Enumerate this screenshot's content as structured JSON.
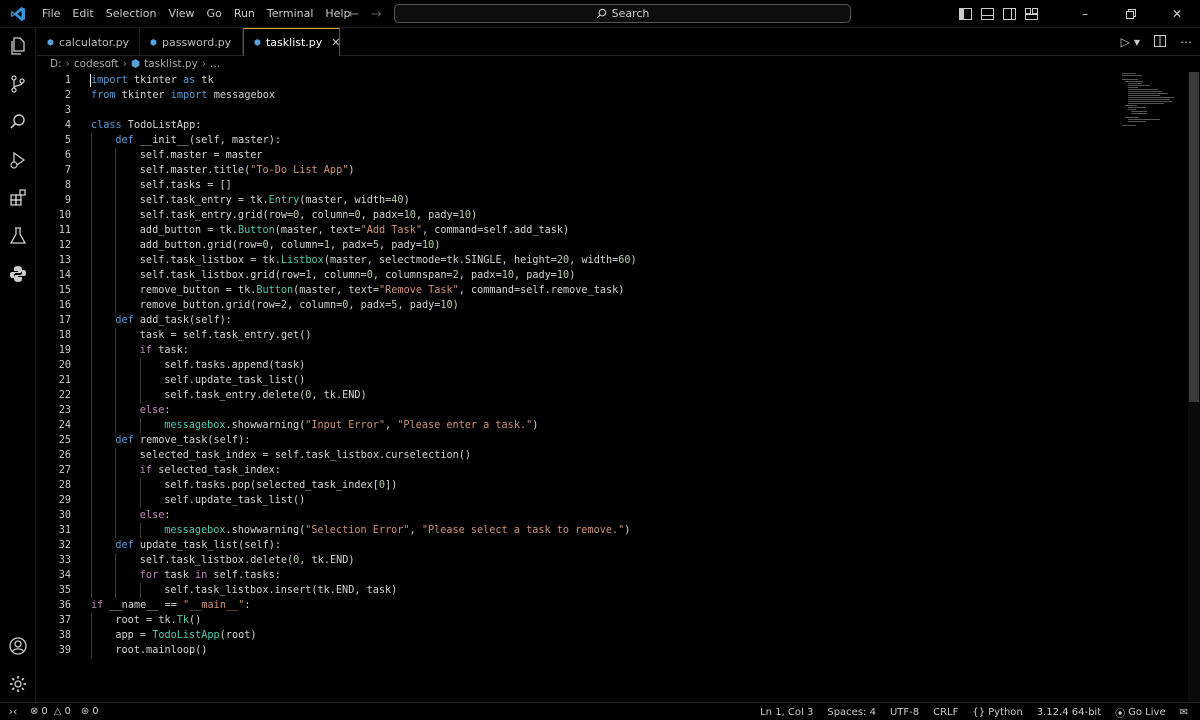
{
  "menu": [
    "File",
    "Edit",
    "Selection",
    "View",
    "Go",
    "Run",
    "Terminal",
    "Help"
  ],
  "search": {
    "label": "Search"
  },
  "tabs": [
    {
      "label": "calculator.py",
      "active": false
    },
    {
      "label": "password.py",
      "active": false
    },
    {
      "label": "tasklist.py",
      "active": true
    }
  ],
  "breadcrumb": {
    "drive": "D:",
    "folder": "codesoft",
    "file": "tasklist.py",
    "more": "..."
  },
  "code_lines": [
    {
      "n": "1",
      "indent": 0,
      "tokens": [
        [
          "import",
          "kw"
        ],
        [
          " tkinter ",
          "plain"
        ],
        [
          "as",
          "kw"
        ],
        [
          " tk",
          "plain"
        ]
      ]
    },
    {
      "n": "2",
      "indent": 0,
      "tokens": [
        [
          "from",
          "kw"
        ],
        [
          " tkinter ",
          "plain"
        ],
        [
          "import",
          "kw"
        ],
        [
          " messagebox",
          "plain"
        ]
      ]
    },
    {
      "n": "3",
      "indent": 0,
      "tokens": []
    },
    {
      "n": "4",
      "indent": 0,
      "tokens": [
        [
          "class",
          "kw"
        ],
        [
          " TodoListApp:",
          "plain"
        ]
      ]
    },
    {
      "n": "5",
      "indent": 1,
      "tokens": [
        [
          "def",
          "kw"
        ],
        [
          " __init__(self, master):",
          "plain"
        ]
      ]
    },
    {
      "n": "6",
      "indent": 2,
      "tokens": [
        [
          "self.master = master",
          "plain"
        ]
      ]
    },
    {
      "n": "7",
      "indent": 2,
      "tokens": [
        [
          "self.master.title(",
          "plain"
        ],
        [
          "\"To-Do List App\"",
          "str"
        ],
        [
          ")",
          "plain"
        ]
      ]
    },
    {
      "n": "8",
      "indent": 2,
      "tokens": [
        [
          "self.tasks = []",
          "plain"
        ]
      ]
    },
    {
      "n": "9",
      "indent": 2,
      "tokens": [
        [
          "self.task_entry = tk.",
          "plain"
        ],
        [
          "Entry",
          "cls"
        ],
        [
          "(master, width=",
          "plain"
        ],
        [
          "40",
          "num"
        ],
        [
          ")",
          "plain"
        ]
      ]
    },
    {
      "n": "10",
      "indent": 2,
      "tokens": [
        [
          "self.task_entry.grid(row=",
          "plain"
        ],
        [
          "0",
          "num"
        ],
        [
          ", column=",
          "plain"
        ],
        [
          "0",
          "num"
        ],
        [
          ", padx=",
          "plain"
        ],
        [
          "10",
          "num"
        ],
        [
          ", pady=",
          "plain"
        ],
        [
          "10",
          "num"
        ],
        [
          ")",
          "plain"
        ]
      ]
    },
    {
      "n": "11",
      "indent": 2,
      "tokens": [
        [
          "add_button = tk.",
          "plain"
        ],
        [
          "Button",
          "cls"
        ],
        [
          "(master, text=",
          "plain"
        ],
        [
          "\"Add Task\"",
          "str"
        ],
        [
          ", command=self.add_task)",
          "plain"
        ]
      ]
    },
    {
      "n": "12",
      "indent": 2,
      "tokens": [
        [
          "add_button.grid(row=",
          "plain"
        ],
        [
          "0",
          "num"
        ],
        [
          ", column=",
          "plain"
        ],
        [
          "1",
          "num"
        ],
        [
          ", padx=",
          "plain"
        ],
        [
          "5",
          "num"
        ],
        [
          ", pady=",
          "plain"
        ],
        [
          "10",
          "num"
        ],
        [
          ")",
          "plain"
        ]
      ]
    },
    {
      "n": "13",
      "indent": 2,
      "tokens": [
        [
          "self.task_listbox = tk.",
          "plain"
        ],
        [
          "Listbox",
          "cls"
        ],
        [
          "(master, selectmode=tk.SINGLE, height=",
          "plain"
        ],
        [
          "20",
          "num"
        ],
        [
          ", width=",
          "plain"
        ],
        [
          "60",
          "num"
        ],
        [
          ")",
          "plain"
        ]
      ]
    },
    {
      "n": "14",
      "indent": 2,
      "tokens": [
        [
          "self.task_listbox.grid(row=",
          "plain"
        ],
        [
          "1",
          "num"
        ],
        [
          ", column=",
          "plain"
        ],
        [
          "0",
          "num"
        ],
        [
          ", columnspan=",
          "plain"
        ],
        [
          "2",
          "num"
        ],
        [
          ", padx=",
          "plain"
        ],
        [
          "10",
          "num"
        ],
        [
          ", pady=",
          "plain"
        ],
        [
          "10",
          "num"
        ],
        [
          ")",
          "plain"
        ]
      ]
    },
    {
      "n": "15",
      "indent": 2,
      "tokens": [
        [
          "remove_button = tk.",
          "plain"
        ],
        [
          "Button",
          "cls"
        ],
        [
          "(master, text=",
          "plain"
        ],
        [
          "\"Remove Task\"",
          "str"
        ],
        [
          ", command=self.remove_task)",
          "plain"
        ]
      ]
    },
    {
      "n": "16",
      "indent": 2,
      "tokens": [
        [
          "remove_button.grid(row=",
          "plain"
        ],
        [
          "2",
          "num"
        ],
        [
          ", column=",
          "plain"
        ],
        [
          "0",
          "num"
        ],
        [
          ", padx=",
          "plain"
        ],
        [
          "5",
          "num"
        ],
        [
          ", pady=",
          "plain"
        ],
        [
          "10",
          "num"
        ],
        [
          ")",
          "plain"
        ]
      ]
    },
    {
      "n": "17",
      "indent": 1,
      "tokens": [
        [
          "def",
          "kw"
        ],
        [
          " add_task(self):",
          "plain"
        ]
      ]
    },
    {
      "n": "18",
      "indent": 2,
      "tokens": [
        [
          "task = self.task_entry.get()",
          "plain"
        ]
      ]
    },
    {
      "n": "19",
      "indent": 2,
      "tokens": [
        [
          "if",
          "kw2"
        ],
        [
          " task:",
          "plain"
        ]
      ]
    },
    {
      "n": "20",
      "indent": 3,
      "tokens": [
        [
          "self.tasks.append(task)",
          "plain"
        ]
      ]
    },
    {
      "n": "21",
      "indent": 3,
      "tokens": [
        [
          "self.update_task_list()",
          "plain"
        ]
      ]
    },
    {
      "n": "22",
      "indent": 3,
      "tokens": [
        [
          "self.task_entry.delete(",
          "plain"
        ],
        [
          "0",
          "num"
        ],
        [
          ", tk.END)",
          "plain"
        ]
      ]
    },
    {
      "n": "23",
      "indent": 2,
      "tokens": [
        [
          "else",
          "kw2"
        ],
        [
          ":",
          "plain"
        ]
      ]
    },
    {
      "n": "24",
      "indent": 3,
      "tokens": [
        [
          "messagebox",
          "cls"
        ],
        [
          ".showwarning(",
          "plain"
        ],
        [
          "\"Input Error\"",
          "str"
        ],
        [
          ", ",
          "plain"
        ],
        [
          "\"Please enter a task.\"",
          "str"
        ],
        [
          ")",
          "plain"
        ]
      ]
    },
    {
      "n": "25",
      "indent": 1,
      "tokens": [
        [
          "def",
          "kw"
        ],
        [
          " remove_task(self):",
          "plain"
        ]
      ]
    },
    {
      "n": "26",
      "indent": 2,
      "tokens": [
        [
          "selected_task_index = self.task_listbox.curselection()",
          "plain"
        ]
      ]
    },
    {
      "n": "27",
      "indent": 2,
      "tokens": [
        [
          "if",
          "kw2"
        ],
        [
          " selected_task_index:",
          "plain"
        ]
      ]
    },
    {
      "n": "28",
      "indent": 3,
      "tokens": [
        [
          "self.tasks.pop(selected_task_index[",
          "plain"
        ],
        [
          "0",
          "num"
        ],
        [
          "])",
          "plain"
        ]
      ]
    },
    {
      "n": "29",
      "indent": 3,
      "tokens": [
        [
          "self.update_task_list()",
          "plain"
        ]
      ]
    },
    {
      "n": "30",
      "indent": 2,
      "tokens": [
        [
          "else",
          "kw2"
        ],
        [
          ":",
          "plain"
        ]
      ]
    },
    {
      "n": "31",
      "indent": 3,
      "tokens": [
        [
          "messagebox",
          "cls"
        ],
        [
          ".showwarning(",
          "plain"
        ],
        [
          "\"Selection Error\"",
          "str"
        ],
        [
          ", ",
          "plain"
        ],
        [
          "\"Please select a task to remove.\"",
          "str"
        ],
        [
          ")",
          "plain"
        ]
      ]
    },
    {
      "n": "32",
      "indent": 1,
      "tokens": [
        [
          "def",
          "kw"
        ],
        [
          " update_task_list(self):",
          "plain"
        ]
      ]
    },
    {
      "n": "33",
      "indent": 2,
      "tokens": [
        [
          "self.task_listbox.delete(",
          "plain"
        ],
        [
          "0",
          "num"
        ],
        [
          ", tk.END)",
          "plain"
        ]
      ]
    },
    {
      "n": "34",
      "indent": 2,
      "tokens": [
        [
          "for",
          "kw2"
        ],
        [
          " task ",
          "plain"
        ],
        [
          "in",
          "kw2"
        ],
        [
          " self.tasks:",
          "plain"
        ]
      ]
    },
    {
      "n": "35",
      "indent": 3,
      "tokens": [
        [
          "self.task_listbox.insert(tk.END, task)",
          "plain"
        ]
      ]
    },
    {
      "n": "36",
      "indent": 0,
      "tokens": [
        [
          "if",
          "kw2"
        ],
        [
          " __name__ == ",
          "plain"
        ],
        [
          "\"__main__\"",
          "str"
        ],
        [
          ":",
          "plain"
        ]
      ]
    },
    {
      "n": "37",
      "indent": 1,
      "tokens": [
        [
          "root = tk.",
          "plain"
        ],
        [
          "Tk",
          "cls"
        ],
        [
          "()",
          "plain"
        ]
      ]
    },
    {
      "n": "38",
      "indent": 1,
      "tokens": [
        [
          "app = ",
          "plain"
        ],
        [
          "TodoListApp",
          "cls"
        ],
        [
          "(root)",
          "plain"
        ]
      ]
    },
    {
      "n": "39",
      "indent": 1,
      "tokens": [
        [
          "root.mainloop()",
          "plain"
        ]
      ]
    }
  ],
  "status": {
    "errors": "0",
    "warnings": "0",
    "ports": "0",
    "position": "Ln 1, Col 3",
    "spaces": "Spaces: 4",
    "encoding": "UTF-8",
    "eol": "CRLF",
    "language": "Python",
    "interpreter": "3.12.4 64-bit",
    "golive": "Go Live"
  },
  "colors": {
    "keyword": "#569cd6",
    "control": "#c586c0",
    "string": "#ce9178",
    "number": "#b5cea8",
    "class": "#4ec9b0",
    "text": "#d4d4d4",
    "vscode_blue": "#2f9ae0",
    "python_yellow": "#f5d547"
  }
}
